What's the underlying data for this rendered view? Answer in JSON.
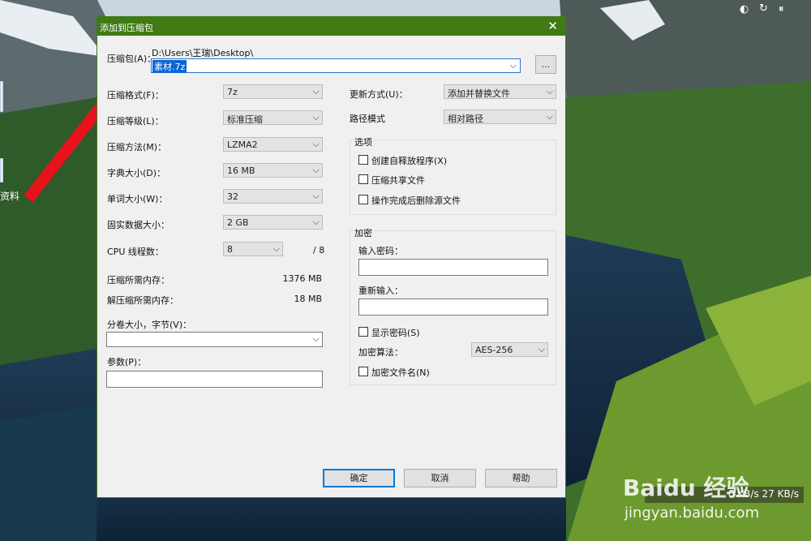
{
  "dialog": {
    "title": "添加到压缩包",
    "archive_label": "压缩包(A)：",
    "archive_path": "D:\\Users\\王瑞\\Desktop\\",
    "archive_name": "素材.7z",
    "browse_label": "...",
    "left": {
      "format_label": "压缩格式(F)：",
      "format_value": "7z",
      "level_label": "压缩等级(L)：",
      "level_value": "标准压缩",
      "method_label": "压缩方法(M)：",
      "method_value": "LZMA2",
      "dict_label": "字典大小(D)：",
      "dict_value": "16 MB",
      "word_label": "单词大小(W)：",
      "word_value": "32",
      "solid_label": "固实数据大小：",
      "solid_value": "2 GB",
      "threads_label": "CPU 线程数：",
      "threads_value": "8",
      "threads_max": "/ 8",
      "mem_comp_label": "压缩所需内存：",
      "mem_comp_value": "1376 MB",
      "mem_decomp_label": "解压缩所需内存：",
      "mem_decomp_value": "18 MB",
      "split_label": "分卷大小，字节(V)：",
      "params_label": "参数(P)："
    },
    "right": {
      "update_label": "更新方式(U)：",
      "update_value": "添加并替换文件",
      "path_label": "路径模式",
      "path_value": "相对路径",
      "options_title": "选项",
      "opt_sfx": "创建自释放程序(X)",
      "opt_shared": "压缩共享文件",
      "opt_delete": "操作完成后删除源文件",
      "encrypt_title": "加密",
      "pwd_label": "输入密码：",
      "pwd_repeat_label": "重新输入：",
      "show_pwd": "显示密码(S)",
      "algo_label": "加密算法：",
      "algo_value": "AES-256",
      "encrypt_names": "加密文件名(N)"
    },
    "buttons": {
      "ok": "确定",
      "cancel": "取消",
      "help": "帮助"
    }
  },
  "desktop": {
    "icon_label": "资料",
    "speed_text": "0 KB/s  27 KB/s",
    "watermark_brand": "Baidu 经验",
    "watermark_url": "jingyan.baidu.com"
  }
}
